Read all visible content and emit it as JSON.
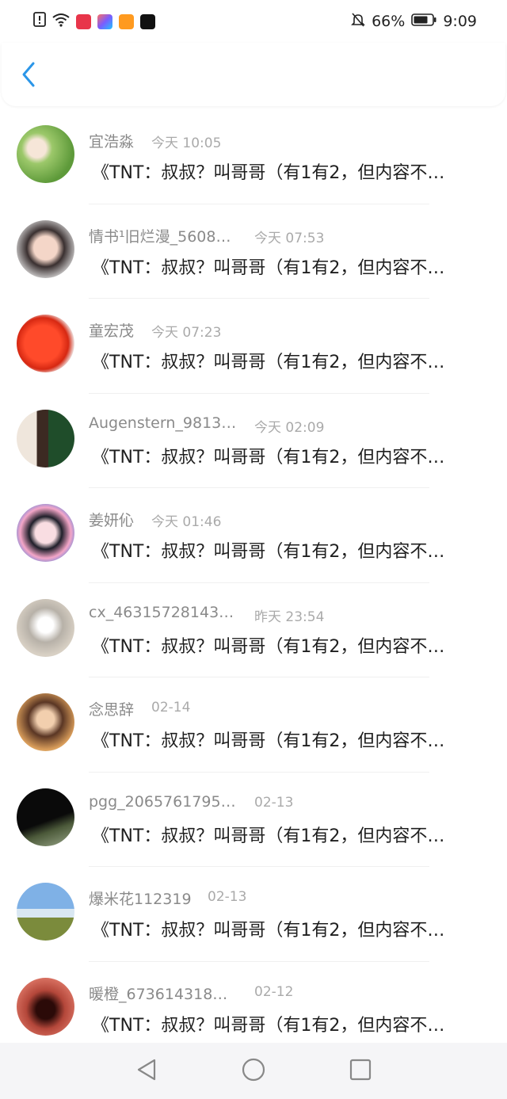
{
  "status_bar": {
    "battery": "66%",
    "time": "9:09",
    "app_icons": [
      "alert-icon",
      "wifi-icon",
      "red-app-icon",
      "puzzle-app-icon",
      "play-app-icon",
      "tiktok-icon"
    ]
  },
  "header": {
    "back_icon": "chevron-left-icon",
    "accent_color": "#2b96e8"
  },
  "list": {
    "items": [
      {
        "name": "宜浩淼",
        "time": "今天 10:05",
        "message": "《TNT：叔叔？叫哥哥（有1有2，但内容不…"
      },
      {
        "name": "情书¹旧烂漫_5608…",
        "time": "今天 07:53",
        "message": "《TNT：叔叔？叫哥哥（有1有2，但内容不…"
      },
      {
        "name": "童宏茂",
        "time": "今天 07:23",
        "message": "《TNT：叔叔？叫哥哥（有1有2，但内容不…"
      },
      {
        "name": "Augenstern_9813…",
        "time": "今天 02:09",
        "message": "《TNT：叔叔？叫哥哥（有1有2，但内容不…"
      },
      {
        "name": "姜妍伈",
        "time": "今天 01:46",
        "message": "《TNT：叔叔？叫哥哥（有1有2，但内容不…"
      },
      {
        "name": "cx_46315728143…",
        "time": "昨天 23:54",
        "message": "《TNT：叔叔？叫哥哥（有1有2，但内容不…"
      },
      {
        "name": "念思辞",
        "time": "02-14",
        "message": "《TNT：叔叔？叫哥哥（有1有2，但内容不…"
      },
      {
        "name": "pgg_2065761795…",
        "time": "02-13",
        "message": "《TNT：叔叔？叫哥哥（有1有2，但内容不…"
      },
      {
        "name": "爆米花112319",
        "time": "02-13",
        "message": "《TNT：叔叔？叫哥哥（有1有2，但内容不…"
      },
      {
        "name": "暖橙_673614318…",
        "time": "02-12",
        "message": "《TNT：叔叔？叫哥哥（有1有2，但内容不…"
      }
    ]
  },
  "nav_bar": {
    "buttons": [
      "back-triangle-icon",
      "home-circle-icon",
      "recents-square-icon"
    ]
  }
}
